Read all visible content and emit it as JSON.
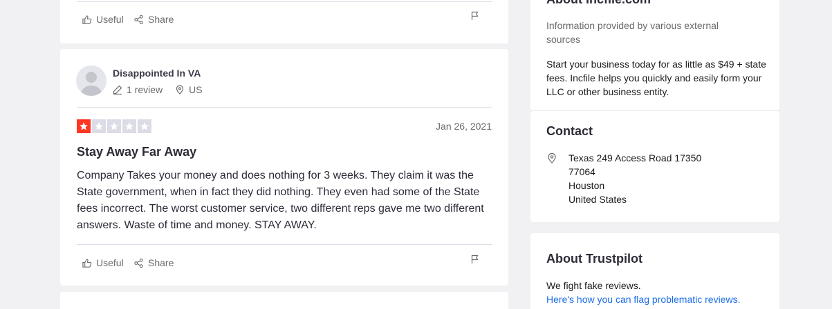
{
  "top_card": {
    "useful_label": "Useful",
    "share_label": "Share"
  },
  "review": {
    "reviewer_name": "Disappointed In VA",
    "review_count": "1 review",
    "country": "US",
    "rating": 1,
    "rating_color": "#ff3722",
    "date": "Jan 26, 2021",
    "title": "Stay Away Far Away",
    "text": "Company Takes your money and does nothing for 3 weeks. They claim it was the State government, when in fact they did nothing. They even had some of the State fees incorrect. The worst customer service, two different reps gave me two different answers. Waste of time and money. STAY AWAY.",
    "useful_label": "Useful",
    "share_label": "Share"
  },
  "about": {
    "title": "About Incfile.com",
    "source_note": "Information provided by various external sources",
    "description": "Start your business today for as little as $49 + state fees. Incfile helps you quickly and easily form your LLC or other business entity."
  },
  "contact": {
    "title": "Contact",
    "address": [
      "Texas 249 Access Road 17350",
      "77064",
      "Houston",
      "United States"
    ]
  },
  "trustpilot": {
    "title": "About Trustpilot",
    "text": "We fight fake reviews.",
    "link": "Here's how you can flag problematic reviews."
  }
}
